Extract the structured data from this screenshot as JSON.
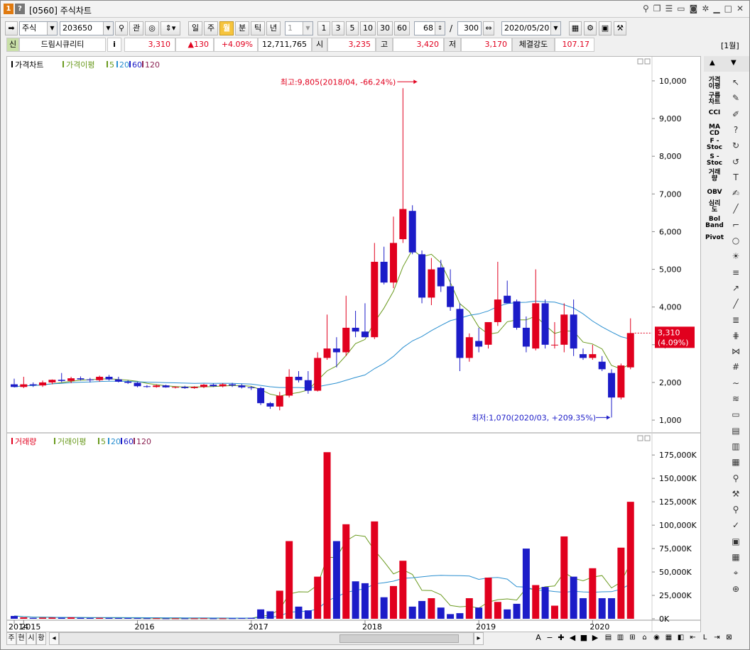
{
  "window": {
    "number": "1",
    "help": "?",
    "title": "[0560] 주식차트"
  },
  "toolbar": {
    "market": "주식",
    "code": "203650",
    "gwan": "관",
    "periods": [
      "일",
      "주",
      "월",
      "분",
      "틱",
      "년"
    ],
    "selected_period": "월",
    "interval_value": "1",
    "quick_counts": [
      "1",
      "3",
      "5",
      "10",
      "30",
      "60"
    ],
    "display_count": "68",
    "slash": "/",
    "total_count": "300",
    "date": "2020/05/20"
  },
  "quote": {
    "badge": "신",
    "name": "드림시큐리티",
    "info": "i",
    "price": "3,310",
    "change": "▲130",
    "change_pct": "+4.09%",
    "volume": "12,711,765",
    "open_label": "시",
    "open": "3,235",
    "high_label": "고",
    "high": "3,420",
    "low_label": "저",
    "low": "3,170",
    "strength_label": "체결강도",
    "strength": "107.17",
    "period_tag": "[1월]"
  },
  "price_panel": {
    "legend_price": "가격차트",
    "legend_ma": "가격이평",
    "ma_periods": [
      "5",
      "20",
      "60",
      "120"
    ],
    "y_ticks": [
      "10,000",
      "9,000",
      "8,000",
      "7,000",
      "6,000",
      "5,000",
      "4,000",
      "3,000",
      "2,000",
      "1,000"
    ],
    "current_price_label": "3,310",
    "current_pct_label": "(4.09%)",
    "high_annotation": "최고:9,805(2018/04, -66.24%)",
    "low_annotation": "최저:1,070(2020/03, +209.35%)"
  },
  "volume_panel": {
    "legend_volume": "거래량",
    "legend_ma": "거래이평",
    "ma_periods": [
      "5",
      "20",
      "60",
      "120"
    ],
    "y_ticks": [
      "175,000K",
      "150,000K",
      "125,000K",
      "100,000K",
      "75,000K",
      "50,000K",
      "25,000K",
      "0K"
    ]
  },
  "x_axis": {
    "labels": [
      "2014",
      "2015",
      "2016",
      "2017",
      "2018",
      "2019",
      "2020"
    ]
  },
  "right_panel": {
    "indicators": [
      "가격\n이평",
      "구름\n차트",
      "CCI",
      "MA\nCD",
      "F -\nStoc",
      "S -\nStoc",
      "거래\n량",
      "OBV",
      "심리\n도",
      "Bol\nBand",
      "Pivot"
    ]
  },
  "bottom_bar": {
    "tabs": [
      "주",
      "현",
      "시",
      "황"
    ],
    "tool_glyphs": [
      "A",
      "−",
      "✚",
      "◀",
      "■",
      "▶"
    ]
  },
  "colors": {
    "up": "#e1001e",
    "down": "#1c1cc8",
    "ma5": "#6a9a1e",
    "ma20": "#2a8fd0",
    "ma60": "#1c1cc8",
    "ma120": "#8b2252",
    "selected_period_bg": "#f6c43d"
  },
  "chart_data": {
    "type": "candlestick",
    "period": "monthly",
    "price_ylim": [
      700,
      10300
    ],
    "volume_ylim_k": [
      0,
      185000
    ],
    "candles": [
      {
        "t": "2014-12",
        "o": 1950,
        "h": 2100,
        "l": 1870,
        "c": 1880,
        "v": 3000
      },
      {
        "t": "2015-01",
        "o": 1880,
        "h": 2150,
        "l": 1850,
        "c": 1950,
        "v": 1500
      },
      {
        "t": "2015-02",
        "o": 1950,
        "h": 2000,
        "l": 1880,
        "c": 1920,
        "v": 1000
      },
      {
        "t": "2015-03",
        "o": 1920,
        "h": 2050,
        "l": 1880,
        "c": 2000,
        "v": 1200
      },
      {
        "t": "2015-04",
        "o": 2000,
        "h": 2080,
        "l": 1950,
        "c": 2070,
        "v": 1300
      },
      {
        "t": "2015-05",
        "o": 2070,
        "h": 2250,
        "l": 2000,
        "c": 2040,
        "v": 1100
      },
      {
        "t": "2015-06",
        "o": 2040,
        "h": 2150,
        "l": 1980,
        "c": 2110,
        "v": 1500
      },
      {
        "t": "2015-07",
        "o": 2110,
        "h": 2160,
        "l": 2050,
        "c": 2080,
        "v": 1000
      },
      {
        "t": "2015-08",
        "o": 2080,
        "h": 2120,
        "l": 2000,
        "c": 2060,
        "v": 900
      },
      {
        "t": "2015-09",
        "o": 2060,
        "h": 2180,
        "l": 2020,
        "c": 2150,
        "v": 1000
      },
      {
        "t": "2015-10",
        "o": 2150,
        "h": 2200,
        "l": 2050,
        "c": 2080,
        "v": 900
      },
      {
        "t": "2015-11",
        "o": 2080,
        "h": 2150,
        "l": 2000,
        "c": 2020,
        "v": 800
      },
      {
        "t": "2015-12",
        "o": 2020,
        "h": 2060,
        "l": 1960,
        "c": 1990,
        "v": 800
      },
      {
        "t": "2016-01",
        "o": 1990,
        "h": 2010,
        "l": 1870,
        "c": 1900,
        "v": 700
      },
      {
        "t": "2016-02",
        "o": 1900,
        "h": 1930,
        "l": 1860,
        "c": 1880,
        "v": 600
      },
      {
        "t": "2016-03",
        "o": 1880,
        "h": 1950,
        "l": 1860,
        "c": 1920,
        "v": 600
      },
      {
        "t": "2016-04",
        "o": 1920,
        "h": 1940,
        "l": 1860,
        "c": 1870,
        "v": 500
      },
      {
        "t": "2016-05",
        "o": 1870,
        "h": 1900,
        "l": 1840,
        "c": 1880,
        "v": 500
      },
      {
        "t": "2016-06",
        "o": 1880,
        "h": 1910,
        "l": 1830,
        "c": 1850,
        "v": 500
      },
      {
        "t": "2016-07",
        "o": 1850,
        "h": 1900,
        "l": 1830,
        "c": 1880,
        "v": 500
      },
      {
        "t": "2016-08",
        "o": 1880,
        "h": 1960,
        "l": 1850,
        "c": 1940,
        "v": 600
      },
      {
        "t": "2016-09",
        "o": 1940,
        "h": 1970,
        "l": 1880,
        "c": 1900,
        "v": 500
      },
      {
        "t": "2016-10",
        "o": 1900,
        "h": 1980,
        "l": 1870,
        "c": 1950,
        "v": 500
      },
      {
        "t": "2016-11",
        "o": 1950,
        "h": 1990,
        "l": 1880,
        "c": 1920,
        "v": 600
      },
      {
        "t": "2016-12",
        "o": 1920,
        "h": 1960,
        "l": 1840,
        "c": 1870,
        "v": 700
      },
      {
        "t": "2017-01",
        "o": 1870,
        "h": 1900,
        "l": 1800,
        "c": 1850,
        "v": 900
      },
      {
        "t": "2017-02",
        "o": 1850,
        "h": 1880,
        "l": 1400,
        "c": 1450,
        "v": 10000
      },
      {
        "t": "2017-03",
        "o": 1450,
        "h": 1480,
        "l": 1300,
        "c": 1360,
        "v": 8000
      },
      {
        "t": "2017-04",
        "o": 1360,
        "h": 1750,
        "l": 1260,
        "c": 1650,
        "v": 30000
      },
      {
        "t": "2017-05",
        "o": 1650,
        "h": 2350,
        "l": 1600,
        "c": 2150,
        "v": 83000
      },
      {
        "t": "2017-06",
        "o": 2150,
        "h": 2300,
        "l": 2000,
        "c": 2060,
        "v": 13000
      },
      {
        "t": "2017-07",
        "o": 2060,
        "h": 2300,
        "l": 1700,
        "c": 1780,
        "v": 9000
      },
      {
        "t": "2017-08",
        "o": 1780,
        "h": 2800,
        "l": 1760,
        "c": 2650,
        "v": 45000
      },
      {
        "t": "2017-09",
        "o": 2650,
        "h": 3800,
        "l": 2600,
        "c": 2900,
        "v": 178000
      },
      {
        "t": "2017-10",
        "o": 2900,
        "h": 3200,
        "l": 2400,
        "c": 2800,
        "v": 83000
      },
      {
        "t": "2017-11",
        "o": 2800,
        "h": 4300,
        "l": 2700,
        "c": 3450,
        "v": 101000
      },
      {
        "t": "2017-12",
        "o": 3450,
        "h": 3900,
        "l": 3200,
        "c": 3350,
        "v": 40000
      },
      {
        "t": "2018-01",
        "o": 3350,
        "h": 4100,
        "l": 3200,
        "c": 3200,
        "v": 38000
      },
      {
        "t": "2018-02",
        "o": 3200,
        "h": 5700,
        "l": 3150,
        "c": 5200,
        "v": 104000
      },
      {
        "t": "2018-03",
        "o": 5200,
        "h": 5600,
        "l": 4600,
        "c": 4650,
        "v": 23000
      },
      {
        "t": "2018-04",
        "o": 4650,
        "h": 6400,
        "l": 4500,
        "c": 5700,
        "v": 35000
      },
      {
        "t": "2018-05",
        "o": 5800,
        "h": 9805,
        "l": 5700,
        "c": 6600,
        "v": 62000
      },
      {
        "t": "2018-06",
        "o": 6550,
        "h": 6700,
        "l": 5400,
        "c": 5450,
        "v": 13000
      },
      {
        "t": "2018-07",
        "o": 5400,
        "h": 5500,
        "l": 4100,
        "c": 4250,
        "v": 19000
      },
      {
        "t": "2018-08",
        "o": 4250,
        "h": 5300,
        "l": 4050,
        "c": 5000,
        "v": 22000
      },
      {
        "t": "2018-09",
        "o": 5050,
        "h": 5250,
        "l": 4400,
        "c": 4550,
        "v": 12000
      },
      {
        "t": "2018-10",
        "o": 4550,
        "h": 5000,
        "l": 3900,
        "c": 4000,
        "v": 5000
      },
      {
        "t": "2018-11",
        "o": 3950,
        "h": 4100,
        "l": 2300,
        "c": 2650,
        "v": 6000
      },
      {
        "t": "2018-12",
        "o": 2650,
        "h": 3300,
        "l": 2550,
        "c": 3200,
        "v": 22000
      },
      {
        "t": "2019-01",
        "o": 3100,
        "h": 3450,
        "l": 2800,
        "c": 2950,
        "v": 12000
      },
      {
        "t": "2019-02",
        "o": 3000,
        "h": 3600,
        "l": 2900,
        "c": 3600,
        "v": 44000
      },
      {
        "t": "2019-03",
        "o": 3600,
        "h": 5200,
        "l": 3500,
        "c": 4200,
        "v": 18000
      },
      {
        "t": "2019-04",
        "o": 4300,
        "h": 4700,
        "l": 4100,
        "c": 4100,
        "v": 10000
      },
      {
        "t": "2019-05",
        "o": 4150,
        "h": 4200,
        "l": 3400,
        "c": 3450,
        "v": 16000
      },
      {
        "t": "2019-06",
        "o": 3450,
        "h": 3750,
        "l": 2800,
        "c": 2950,
        "v": 75000
      },
      {
        "t": "2019-07",
        "o": 2900,
        "h": 5000,
        "l": 2850,
        "c": 4100,
        "v": 36000
      },
      {
        "t": "2019-08",
        "o": 4100,
        "h": 4200,
        "l": 2900,
        "c": 3000,
        "v": 34000
      },
      {
        "t": "2019-09",
        "o": 3000,
        "h": 3600,
        "l": 2900,
        "c": 3000,
        "v": 14000
      },
      {
        "t": "2019-10",
        "o": 3000,
        "h": 4100,
        "l": 2800,
        "c": 3800,
        "v": 88000
      },
      {
        "t": "2019-11",
        "o": 3800,
        "h": 4200,
        "l": 2700,
        "c": 2900,
        "v": 45000
      },
      {
        "t": "2019-12",
        "o": 2750,
        "h": 2900,
        "l": 2600,
        "c": 2650,
        "v": 22000
      },
      {
        "t": "2020-01",
        "o": 2650,
        "h": 3000,
        "l": 2600,
        "c": 2750,
        "v": 54000
      },
      {
        "t": "2020-02",
        "o": 2550,
        "h": 2700,
        "l": 2300,
        "c": 2350,
        "v": 22000
      },
      {
        "t": "2020-03",
        "o": 2250,
        "h": 2350,
        "l": 1070,
        "c": 1600,
        "v": 22000
      },
      {
        "t": "2020-04",
        "o": 1600,
        "h": 2500,
        "l": 1550,
        "c": 2450,
        "v": 76000
      },
      {
        "t": "2020-05",
        "o": 2400,
        "h": 3700,
        "l": 2350,
        "c": 3310,
        "v": 125000
      }
    ]
  }
}
